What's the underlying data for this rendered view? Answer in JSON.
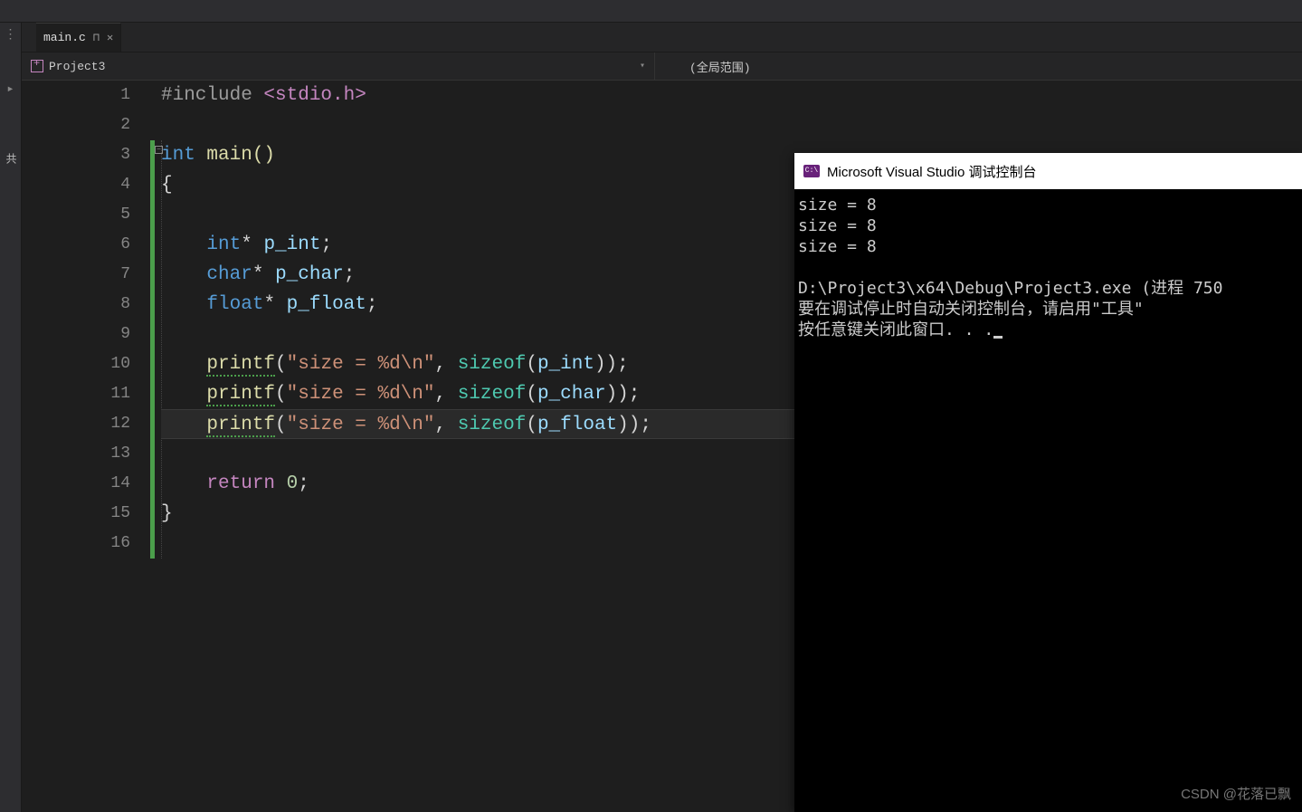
{
  "tab": {
    "filename": "main.c"
  },
  "nav": {
    "project": "Project3",
    "scope": "(全局范围)"
  },
  "sidebar": {
    "label": "共"
  },
  "lines": [
    "1",
    "2",
    "3",
    "4",
    "5",
    "6",
    "7",
    "8",
    "9",
    "10",
    "11",
    "12",
    "13",
    "14",
    "15",
    "16"
  ],
  "code": {
    "l1_include": "#include ",
    "l1_header": "<stdio.h>",
    "l3_int": "int",
    "l3_main": " main()",
    "l4_brace": "{",
    "l6_int": "int",
    "l6_star": "* ",
    "l6_var": "p_int",
    "l6_semi": ";",
    "l7_char": "char",
    "l7_star": "* ",
    "l7_var": "p_char",
    "l7_semi": ";",
    "l8_float": "float",
    "l8_star": "* ",
    "l8_var": "p_float",
    "l8_semi": ";",
    "l10_printf": "printf",
    "l10_open": "(",
    "l10_str": "\"size = %d\\n\"",
    "l10_comma": ", ",
    "l10_sizeof": "sizeof",
    "l10_open2": "(",
    "l10_var": "p_int",
    "l10_close": "));",
    "l11_printf": "printf",
    "l11_open": "(",
    "l11_str": "\"size = %d\\n\"",
    "l11_comma": ", ",
    "l11_sizeof": "sizeof",
    "l11_open2": "(",
    "l11_var": "p_char",
    "l11_close": "));",
    "l12_printf": "printf",
    "l12_open": "(",
    "l12_str": "\"size = %d\\n\"",
    "l12_comma": ", ",
    "l12_sizeof": "sizeof",
    "l12_open2": "(",
    "l12_var": "p_float",
    "l12_close": "));",
    "l14_return": "return",
    "l14_sp": " ",
    "l14_zero": "0",
    "l14_semi": ";",
    "l15_brace": "}"
  },
  "console": {
    "title": "Microsoft Visual Studio 调试控制台",
    "out1": "size = 8",
    "out2": "size = 8",
    "out3": "size = 8",
    "path": "D:\\Project3\\x64\\Debug\\Project3.exe (进程 750",
    "hint": "要在调试停止时自动关闭控制台，请启用\"工具\"",
    "prompt": "按任意键关闭此窗口. . ."
  },
  "watermark": "CSDN @花落已飘"
}
